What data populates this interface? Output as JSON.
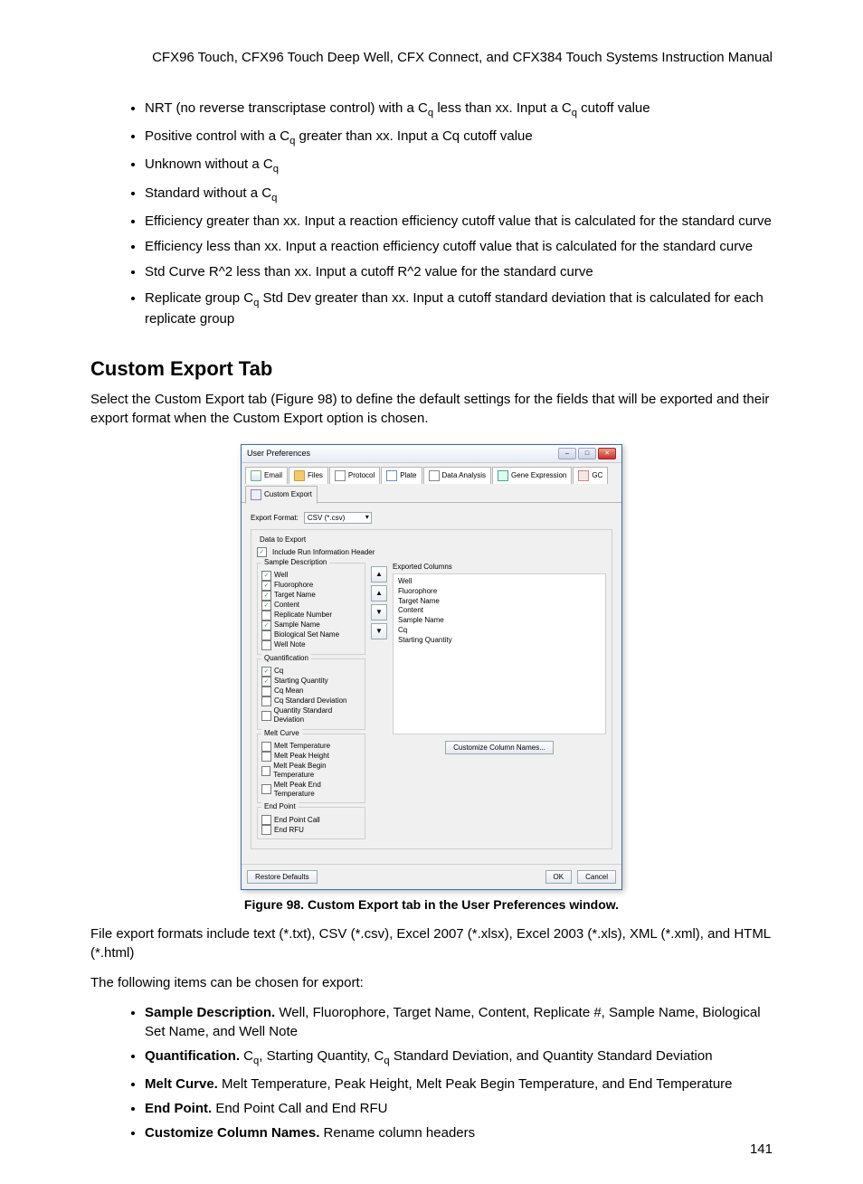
{
  "header": "CFX96 Touch, CFX96 Touch Deep Well, CFX Connect, and CFX384 Touch Systems Instruction Manual",
  "top_bullets": [
    {
      "pre": "NRT (no reverse transcriptase control) with a C",
      "sub": "q",
      "mid": " less than xx. Input a C",
      "sub2": "q",
      "post": " cutoff value"
    },
    {
      "pre": "Positive control with a C",
      "sub": "q",
      "mid": " greater than xx. Input a Cq cutoff value",
      "sub2": "",
      "post": ""
    },
    {
      "pre": "Unknown without a C",
      "sub": "q",
      "mid": "",
      "sub2": "",
      "post": ""
    },
    {
      "pre": "Standard without a C",
      "sub": "q",
      "mid": "",
      "sub2": "",
      "post": ""
    },
    {
      "pre": "Efficiency greater than xx. Input a reaction efficiency cutoff value that is calculated for the standard curve",
      "sub": "",
      "mid": "",
      "sub2": "",
      "post": ""
    },
    {
      "pre": "Efficiency less than xx. Input a reaction efficiency cutoff value that is calculated for the standard curve",
      "sub": "",
      "mid": "",
      "sub2": "",
      "post": ""
    },
    {
      "pre": "Std Curve R^2 less than xx. Input a cutoff R^2 value for the standard curve",
      "sub": "",
      "mid": "",
      "sub2": "",
      "post": ""
    },
    {
      "pre": "Replicate group C",
      "sub": "q",
      "mid": " Std Dev greater than xx. Input a cutoff standard deviation that is calculated for each replicate group",
      "sub2": "",
      "post": ""
    }
  ],
  "section_title": "Custom Export Tab",
  "intro": "Select the Custom Export tab (Figure 98) to define the default settings for the fields that will be exported and their export format when the Custom Export option is chosen.",
  "dialog": {
    "title": "User Preferences",
    "tabs": [
      "Email",
      "Files",
      "Protocol",
      "Plate",
      "Data Analysis",
      "Gene Expression",
      "GC",
      "Custom Export"
    ],
    "export_format_label": "Export Format:",
    "export_format_value": "CSV (*.csv)",
    "data_to_export_label": "Data to Export",
    "include_header_label": "Include Run Information Header",
    "groups": {
      "sample_desc": {
        "label": "Sample Description",
        "items": [
          {
            "t": "Well",
            "c": true
          },
          {
            "t": "Fluorophore",
            "c": true
          },
          {
            "t": "Target Name",
            "c": true
          },
          {
            "t": "Content",
            "c": true
          },
          {
            "t": "Replicate Number",
            "c": false
          },
          {
            "t": "Sample Name",
            "c": true
          },
          {
            "t": "Biological Set Name",
            "c": false
          },
          {
            "t": "Well Note",
            "c": false
          }
        ]
      },
      "quant": {
        "label": "Quantification",
        "items": [
          {
            "t": "Cq",
            "c": true
          },
          {
            "t": "Starting Quantity",
            "c": true
          },
          {
            "t": "Cq Mean",
            "c": false
          },
          {
            "t": "Cq Standard Deviation",
            "c": false
          },
          {
            "t": "Quantity Standard Deviation",
            "c": false
          }
        ]
      },
      "melt": {
        "label": "Melt Curve",
        "items": [
          {
            "t": "Melt Temperature",
            "c": false
          },
          {
            "t": "Melt Peak Height",
            "c": false
          },
          {
            "t": "Melt Peak Begin Temperature",
            "c": false
          },
          {
            "t": "Melt Peak End Temperature",
            "c": false
          }
        ]
      },
      "endpoint": {
        "label": "End Point",
        "items": [
          {
            "t": "End Point Call",
            "c": false
          },
          {
            "t": "End RFU",
            "c": false
          }
        ]
      }
    },
    "exported_label": "Exported Columns",
    "exported_cols": [
      "Well",
      "Fluorophore",
      "Target Name",
      "Content",
      "Sample Name",
      "Cq",
      "Starting Quantity"
    ],
    "customize_btn": "Customize Column Names...",
    "restore_btn": "Restore Defaults",
    "ok": "OK",
    "cancel": "Cancel"
  },
  "figure_caption": "Figure 98. Custom Export tab in the User Preferences window.",
  "post_fig_1": "File export formats include text (*.txt), CSV (*.csv), Excel 2007 (*.xlsx), Excel 2003 (*.xls), XML (*.xml), and HTML (*.html)",
  "post_fig_2": "The following items can be chosen for export:",
  "export_bullets": [
    {
      "b": "Sample Description.",
      "t": " Well, Fluorophore, Target Name, Content, Replicate #, Sample Name, Biological Set Name, and Well Note"
    },
    {
      "b": "Quantification.",
      "t_pre": " C",
      "t_sub": "q",
      "t_mid": ", Starting Quantity, C",
      "t_sub2": "q",
      "t_post": " Standard Deviation, and Quantity Standard Deviation"
    },
    {
      "b": "Melt Curve.",
      "t": " Melt Temperature, Peak Height, Melt Peak Begin Temperature, and End Temperature"
    },
    {
      "b": "End Point.",
      "t": " End Point Call and End RFU"
    },
    {
      "b": "Customize Column Names.",
      "t": " Rename column headers"
    }
  ],
  "page_number": "141"
}
